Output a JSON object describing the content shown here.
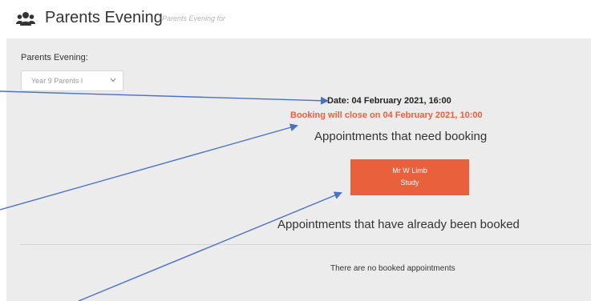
{
  "header": {
    "title": "Parents Evening",
    "subtitle": "Parents Evening for",
    "icon": "users-icon"
  },
  "form": {
    "label": "Parents Evening:",
    "select_value": "Year 9 Parents I"
  },
  "event": {
    "date": "Date: 04 February 2021, 16:00",
    "booking_close": "Booking will close on 04 February 2021, 10:00"
  },
  "sections": {
    "need_booking": "Appointments that need booking",
    "already_booked": "Appointments that have already been booked",
    "no_booked": "There are no booked appointments"
  },
  "appointments_to_book": [
    {
      "teacher": "Mr W Limb",
      "subject": "Study"
    }
  ],
  "colors": {
    "accent": "#e8603c",
    "warning_text": "#e8613d",
    "annotation_arrow": "#4a72c4"
  }
}
